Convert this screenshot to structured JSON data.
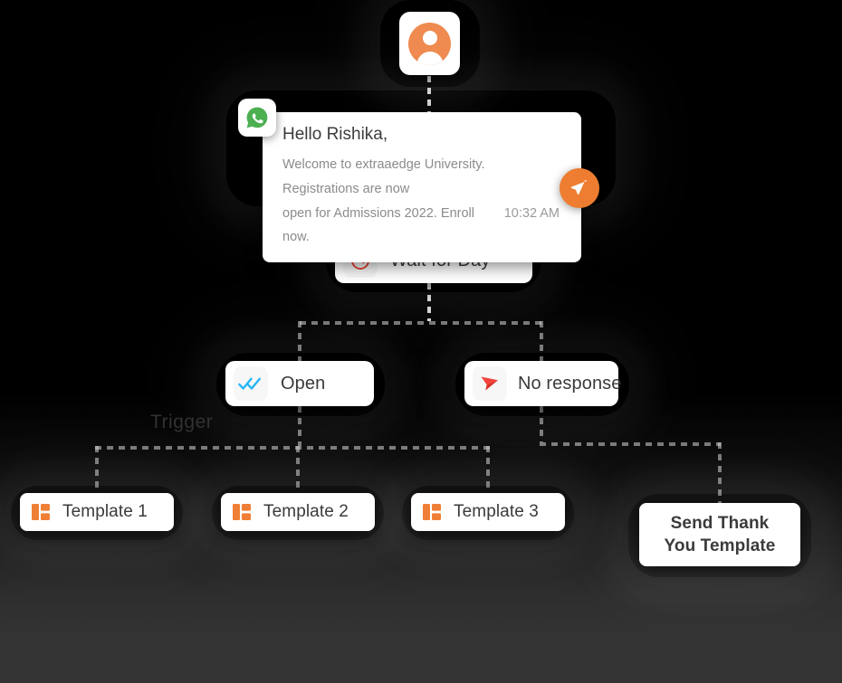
{
  "canvas": {
    "background_top": "#000000",
    "background_bottom": "#333333",
    "connector_color": "#d4d4d4"
  },
  "flow": {
    "trigger": {
      "icon": "user-avatar-icon",
      "accent": "#ef8b50"
    },
    "message": {
      "channel_icon": "whatsapp-icon",
      "greeting": "Hello Rishika,",
      "body": "Welcome to extraaedge University. Registrations are now open for Admissions 2022. Enroll now.",
      "body_line1": "Welcome to extraaedge University. Registrations are now",
      "body_line2": "open for Admissions 2022. Enroll now.",
      "time": "10:32 AM",
      "send_icon": "send-paper-plane-icon",
      "send_accent": "#ee7d31"
    },
    "wait": {
      "label": "Wait for Day",
      "icon": "clock-icon",
      "icon_color": "#e8412f"
    },
    "branches": [
      {
        "label": "Open",
        "icon": "double-check-icon",
        "icon_color": "#29b6f6"
      },
      {
        "label": "No response",
        "icon": "no-response-arrow-icon",
        "icon_color": "#f4433c"
      }
    ],
    "templates": [
      {
        "label": "Template 1",
        "icon": "grid-blocks-icon",
        "icon_color": "#ef7f36"
      },
      {
        "label": "Template 2",
        "icon": "grid-blocks-icon",
        "icon_color": "#ef7f36"
      },
      {
        "label": "Template 3",
        "icon": "grid-blocks-icon",
        "icon_color": "#ef7f36"
      }
    ],
    "thanks": {
      "line1": "Send Thank",
      "line2": "You Template"
    },
    "artifact_text": "Trigger"
  }
}
